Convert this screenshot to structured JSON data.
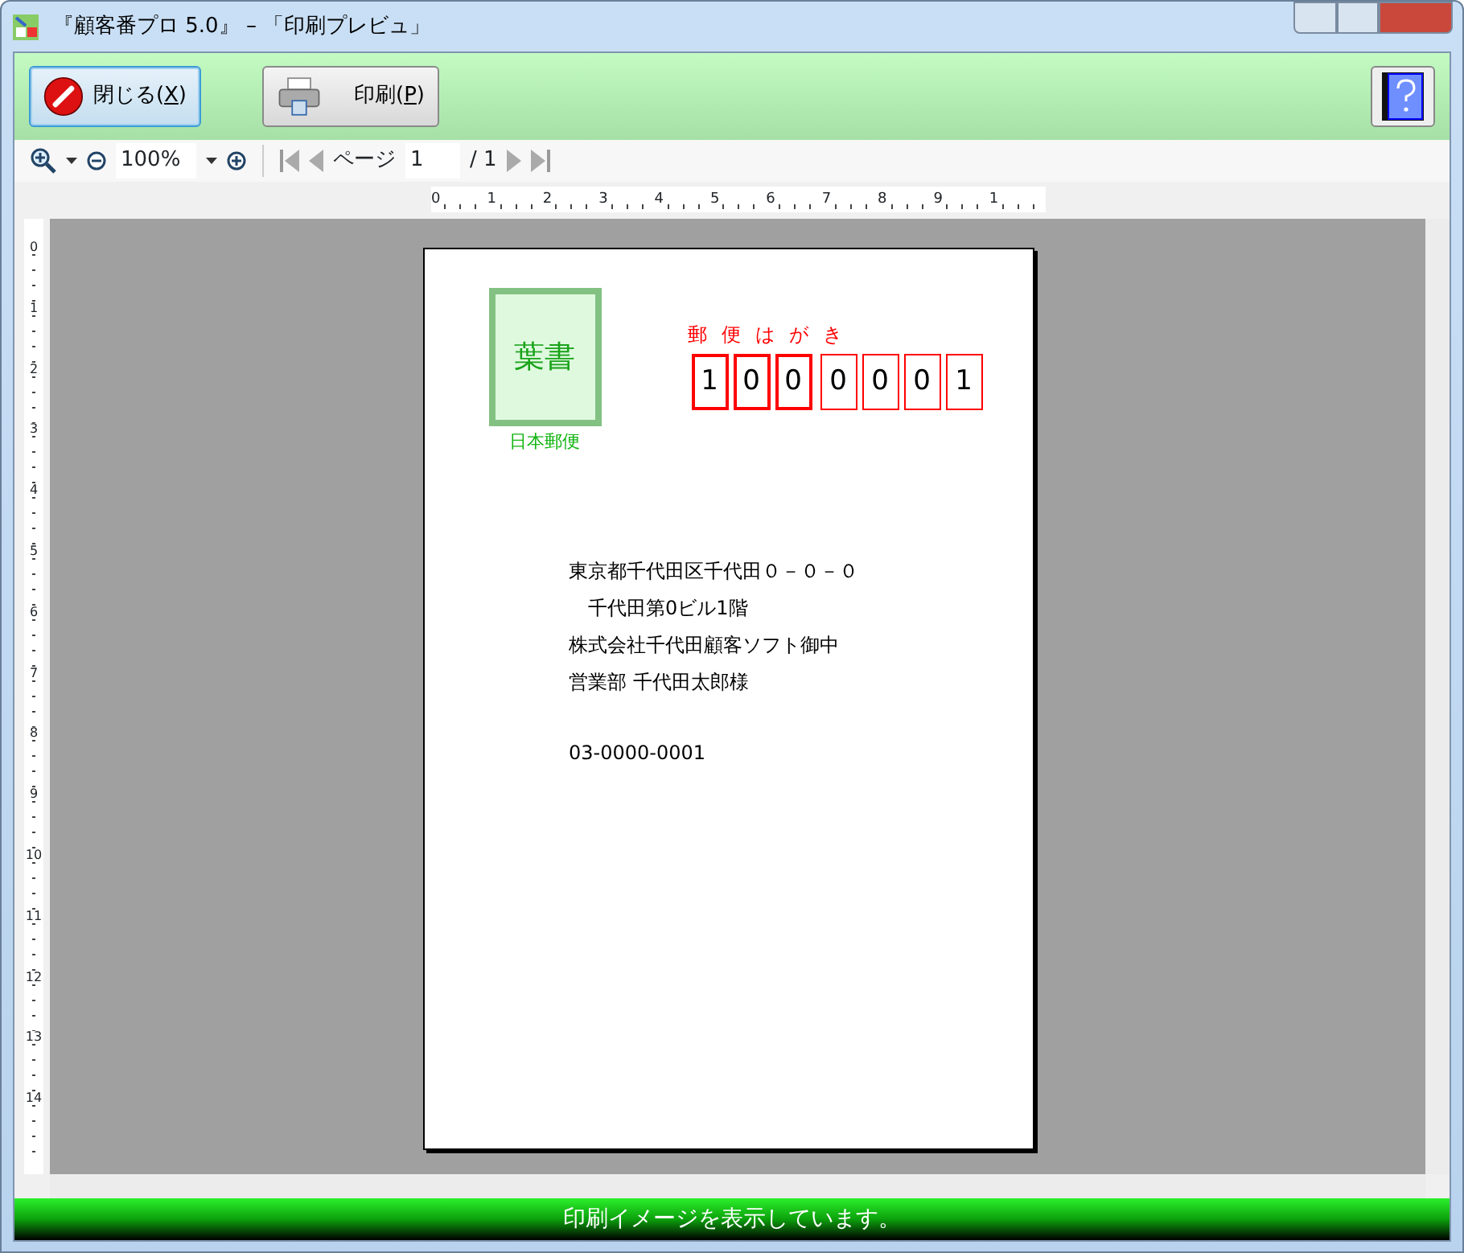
{
  "window": {
    "title": "『顧客番プロ 5.0』 – 「印刷プレビュ」"
  },
  "toolbar": {
    "buttons": [
      {
        "kind": "close",
        "label": "閉じる(",
        "key": "X",
        "suffix": ")",
        "focused": true
      },
      {
        "kind": "print",
        "label": "印刷(",
        "key": "P",
        "suffix": ")",
        "focused": false
      }
    ]
  },
  "zoom_bar": {
    "zoom": "100%",
    "page_label": "ページ",
    "page": "1",
    "page_total": "/ 1"
  },
  "rulers": {
    "horizontal": [
      "0",
      "1",
      "2",
      "3",
      "4",
      "5",
      "6",
      "7",
      "8",
      "9",
      "1"
    ],
    "vertical": [
      "0",
      "1",
      "2",
      "3",
      "4",
      "5",
      "6",
      "7",
      "8",
      "9",
      "10",
      "11",
      "12",
      "13",
      "14"
    ]
  },
  "postcard": {
    "stamp": {
      "text": "葉書",
      "caption": "日本郵便"
    },
    "postal_label": "郵便はがき",
    "postal_digits": [
      {
        "digit": "1",
        "kind": "upper"
      },
      {
        "digit": "0",
        "kind": "upper"
      },
      {
        "digit": "0",
        "kind": "upper"
      },
      {
        "digit": "0",
        "kind": "lower"
      },
      {
        "digit": "0",
        "kind": "lower"
      },
      {
        "digit": "0",
        "kind": "lower"
      },
      {
        "digit": "1",
        "kind": "lower"
      }
    ],
    "address_lines": [
      "東京都千代田区千代田０－０－０",
      "　千代田第0ビル1階",
      "株式会社千代田顧客ソフト御中",
      "営業部 千代田太郎様"
    ],
    "phone": "03-0000-0001"
  },
  "status_bar": "印刷イメージを表示しています。"
}
